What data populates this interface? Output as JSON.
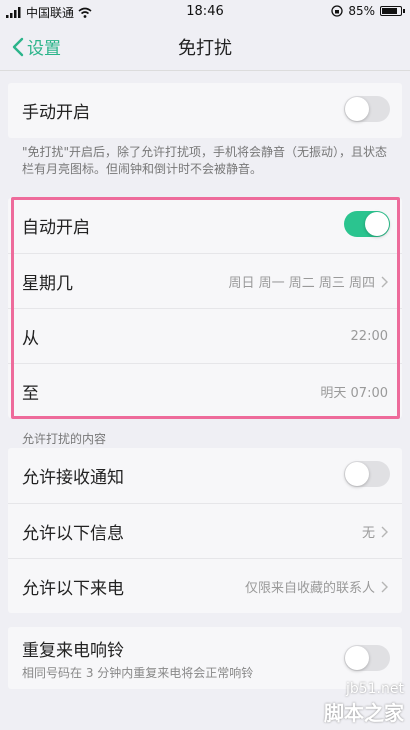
{
  "status": {
    "carrier": "中国联通",
    "time": "18:46",
    "battery": "85%"
  },
  "nav": {
    "back_label": "设置",
    "title": "免打扰"
  },
  "manual": {
    "label": "手动开启",
    "enabled": false
  },
  "note": "\"免打扰\"开启后，除了允许打扰项，手机将会静音（无振动），且状态栏有月亮图标。但闹钟和倒计时不会被静音。",
  "auto": {
    "label": "自动开启",
    "enabled": true,
    "weekdays_label": "星期几",
    "weekdays_value": "周日 周一 周二 周三 周四",
    "from_label": "从",
    "from_value": "22:00",
    "to_label": "至",
    "to_value": "明天 07:00"
  },
  "allowed": {
    "section_label": "允许打扰的内容",
    "notifications_label": "允许接收通知",
    "notifications_enabled": false,
    "messages_label": "允许以下信息",
    "messages_value": "无",
    "calls_label": "允许以下来电",
    "calls_value": "仅限来自收藏的联系人"
  },
  "repeat": {
    "label": "重复来电响铃",
    "sublabel": "相同号码在 3 分钟内重复来电将会正常响铃",
    "enabled": false
  },
  "watermark": {
    "line1": "jb51.net",
    "line2": "脚本之家"
  },
  "colors": {
    "accent": "#2bc48f",
    "highlight": "#ee6b9b",
    "background": "#efeff4"
  }
}
